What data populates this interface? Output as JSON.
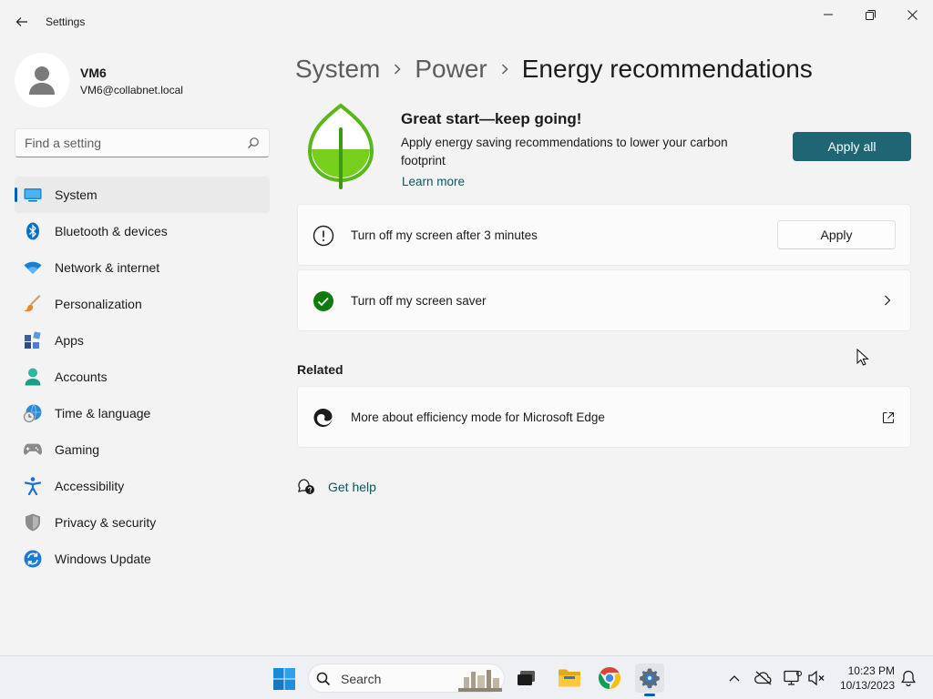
{
  "window": {
    "title": "Settings"
  },
  "profile": {
    "name": "VM6",
    "email": "VM6@collabnet.local"
  },
  "search": {
    "placeholder": "Find a setting"
  },
  "sidebar": {
    "items": [
      {
        "label": "System",
        "icon": "monitor-icon",
        "active": true
      },
      {
        "label": "Bluetooth & devices",
        "icon": "bluetooth-icon"
      },
      {
        "label": "Network & internet",
        "icon": "wifi-icon"
      },
      {
        "label": "Personalization",
        "icon": "brush-icon"
      },
      {
        "label": "Apps",
        "icon": "apps-icon"
      },
      {
        "label": "Accounts",
        "icon": "person-icon"
      },
      {
        "label": "Time & language",
        "icon": "globe-clock-icon"
      },
      {
        "label": "Gaming",
        "icon": "gamepad-icon"
      },
      {
        "label": "Accessibility",
        "icon": "accessibility-icon"
      },
      {
        "label": "Privacy & security",
        "icon": "shield-icon"
      },
      {
        "label": "Windows Update",
        "icon": "update-icon"
      }
    ]
  },
  "breadcrumb": {
    "items": [
      "System",
      "Power"
    ],
    "current": "Energy recommendations"
  },
  "hero": {
    "title": "Great start—keep going!",
    "description": "Apply energy saving recommendations to lower your carbon footprint",
    "link": "Learn more",
    "apply_all": "Apply all"
  },
  "recommendations": [
    {
      "label": "Turn off my screen after 3 minutes",
      "status": "pending",
      "action": "Apply"
    },
    {
      "label": "Turn off my screen saver",
      "status": "done"
    }
  ],
  "related": {
    "heading": "Related",
    "items": [
      {
        "label": "More about efficiency mode for Microsoft Edge"
      }
    ]
  },
  "help": {
    "label": "Get help"
  },
  "taskbar": {
    "search_label": "Search",
    "time": "10:23 PM",
    "date": "10/13/2023"
  },
  "colors": {
    "accent": "#005fb8",
    "apply_all_bg": "#1f6573",
    "leaf_green": "#6cc51b",
    "success": "#0f7b0f"
  }
}
